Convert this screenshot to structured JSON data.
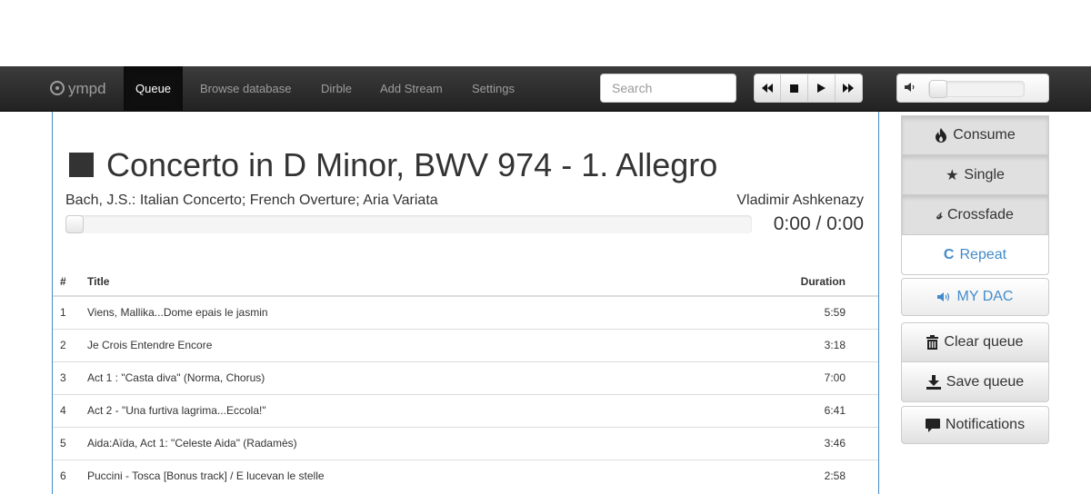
{
  "navbar": {
    "brand": "ympd",
    "items": [
      {
        "label": "Queue",
        "active": true
      },
      {
        "label": "Browse database"
      },
      {
        "label": "Dirble"
      },
      {
        "label": "Add Stream"
      },
      {
        "label": "Settings"
      }
    ],
    "search_placeholder": "Search",
    "controls": [
      "prev-icon",
      "stop-icon",
      "play-icon",
      "next-icon"
    ],
    "volume_level": 0
  },
  "now_playing": {
    "state_icon": "stop-icon",
    "title": "Concerto in D Minor, BWV 974 - 1. Allegro",
    "album": "Bach, J.S.: Italian Concerto; French Overture; Aria Variata",
    "artist": "Vladimir Ashkenazy",
    "time": "0:00 / 0:00",
    "progress": 0
  },
  "queue": {
    "headers": {
      "num": "#",
      "title": "Title",
      "duration": "Duration"
    },
    "rows": [
      {
        "num": "1",
        "title": "Viens, Mallika...Dome epais le jasmin",
        "duration": "5:59"
      },
      {
        "num": "2",
        "title": "Je Crois Entendre Encore",
        "duration": "3:18"
      },
      {
        "num": "3",
        "title": "Act 1 : \"Casta diva\" (Norma, Chorus)",
        "duration": "7:00"
      },
      {
        "num": "4",
        "title": "Act 2 - \"Una furtiva lagrima...Eccola!\"",
        "duration": "6:41"
      },
      {
        "num": "5",
        "title": "Aida:Aïda, Act 1: \"Celeste Aida\" (Radamès)",
        "duration": "3:46"
      },
      {
        "num": "6",
        "title": "Puccini - Tosca [Bonus track] / E lucevan le stelle",
        "duration": "2:58"
      }
    ]
  },
  "sidebar": {
    "consume": "Consume",
    "single": "Single",
    "crossfade": "Crossfade",
    "repeat": "Repeat",
    "output": "MY DAC",
    "clear_queue": "Clear queue",
    "save_queue": "Save queue",
    "notifications": "Notifications"
  },
  "colors": {
    "accent": "#428bca",
    "navbar": "#222222"
  }
}
